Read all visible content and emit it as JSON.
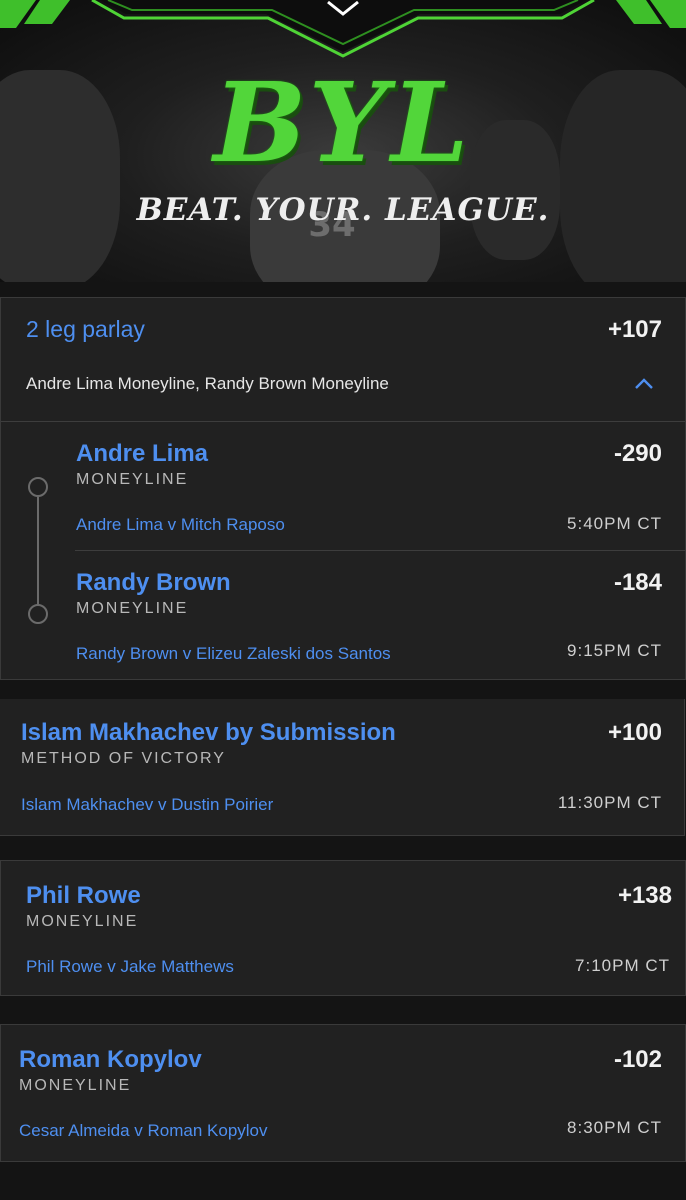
{
  "banner": {
    "logo": "BYL",
    "tagline": "BEAT. YOUR. LEAGUE.",
    "jersey_number": "34"
  },
  "parlay": {
    "title": "2 leg parlay",
    "odds": "+107",
    "summary": "Andre Lima Moneyline, Randy Brown Moneyline",
    "toggle_icon": "chevron-up-icon",
    "legs": [
      {
        "pick": "Andre Lima",
        "market": "MONEYLINE",
        "odds": "-290",
        "matchup": "Andre Lima v Mitch Raposo",
        "time": "5:40PM CT"
      },
      {
        "pick": "Randy Brown",
        "market": "MONEYLINE",
        "odds": "-184",
        "matchup": "Randy Brown v Elizeu Zaleski dos Santos",
        "time": "9:15PM CT"
      }
    ]
  },
  "bets": [
    {
      "pick": "Islam Makhachev by Submission",
      "market": "METHOD OF VICTORY",
      "odds": "+100",
      "matchup": "Islam Makhachev v Dustin Poirier",
      "time": "11:30PM CT"
    },
    {
      "pick": "Phil Rowe",
      "market": "MONEYLINE",
      "odds": "+138",
      "matchup": "Phil Rowe v Jake Matthews",
      "time": "7:10PM CT"
    },
    {
      "pick": "Roman Kopylov",
      "market": "MONEYLINE",
      "odds": "-102",
      "matchup": "Cesar Almeida v Roman Kopylov",
      "time": "8:30PM CT"
    }
  ],
  "colors": {
    "accent_blue": "#4e8ff0",
    "logo_green": "#52d63a",
    "card_bg": "#212121",
    "page_bg": "#141414"
  }
}
